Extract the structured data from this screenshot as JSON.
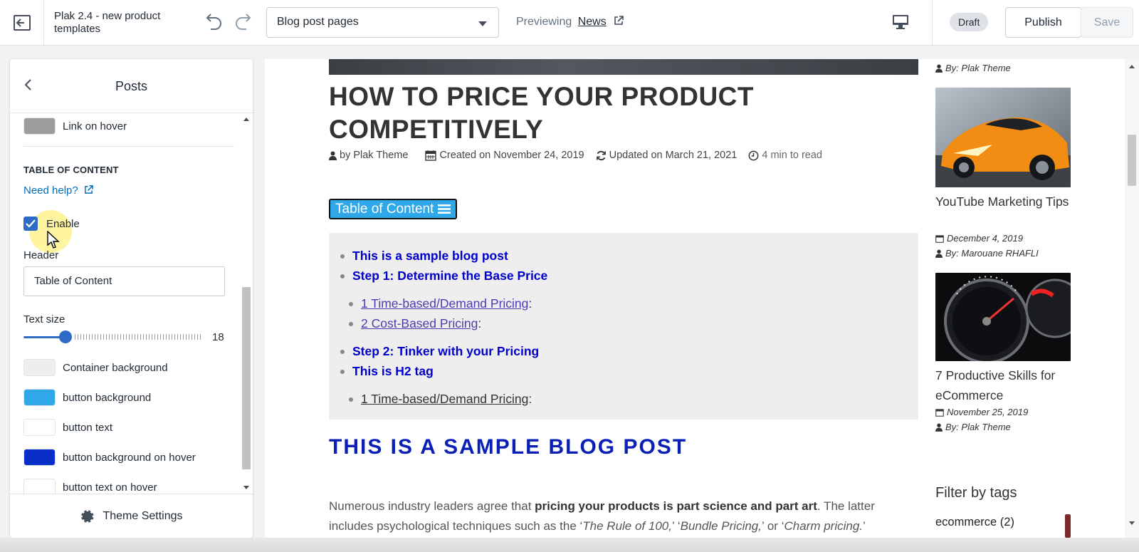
{
  "topbar": {
    "theme_name": "Plak 2.4 - new product templates",
    "page_select": "Blog post pages",
    "previewing_label": "Previewing",
    "previewing_link": "News",
    "draft_badge": "Draft",
    "publish_label": "Publish",
    "save_label": "Save"
  },
  "sidebar": {
    "title": "Posts",
    "link_on_hover_label": "Link on hover",
    "section_title": "TABLE OF CONTENT",
    "help_link": "Need help?",
    "enable_label": "Enable",
    "enable_checked": true,
    "header_label": "Header",
    "header_value": "Table of Content",
    "text_size_label": "Text size",
    "text_size_value": "18",
    "swatches": [
      {
        "label": "Container background",
        "color": "#eeeeee"
      },
      {
        "label": "button background",
        "color": "#2fa8ea"
      },
      {
        "label": "button text",
        "color": "#ffffff"
      },
      {
        "label": "button background on hover",
        "color": "#0a2fc9"
      },
      {
        "label": "button text on hover",
        "color": "#ffffff"
      }
    ],
    "footer_label": "Theme Settings"
  },
  "post": {
    "title": "HOW TO PRICE YOUR PRODUCT COMPETITIVELY",
    "author": "by Plak Theme",
    "created": "Created on November 24, 2019",
    "updated": "Updated on March 21, 2021",
    "read_time": "4 min to read",
    "toc_button": "Table of Content",
    "toc_items": [
      "This is a sample blog post",
      "Step 1: Determine the Base Price",
      "1 Time-based/Demand Pricing",
      "2 Cost-Based Pricing",
      "Step 2: Tinker with your Pricing",
      "This is H2 tag",
      "1 Time-based/Demand Pricing"
    ],
    "colon": ":",
    "h2": "THIS IS A SAMPLE BLOG POST",
    "body_1": "Numerous industry leaders agree that ",
    "body_bold": "pricing your products is part science and part art",
    "body_2": ". The latter includes psychological techniques such as the ‘",
    "body_i1": "The Rule of 100,",
    "body_3": "’ ‘",
    "body_i2": "Bundle Pricing,",
    "body_4": "’ or ‘",
    "body_i3": "Charm pricing.",
    "body_5": "’"
  },
  "right_column": {
    "top_author": "By: Plak Theme",
    "posts": [
      {
        "title": "YouTube Marketing Tips",
        "date": "December 4, 2019",
        "author": "By: Marouane RHAFLI"
      },
      {
        "title": "7 Productive Skills for eCommerce",
        "date": "November 25, 2019",
        "author": "By: Plak Theme"
      }
    ],
    "filter_title": "Filter by tags",
    "tag": "ecommerce (2)"
  }
}
